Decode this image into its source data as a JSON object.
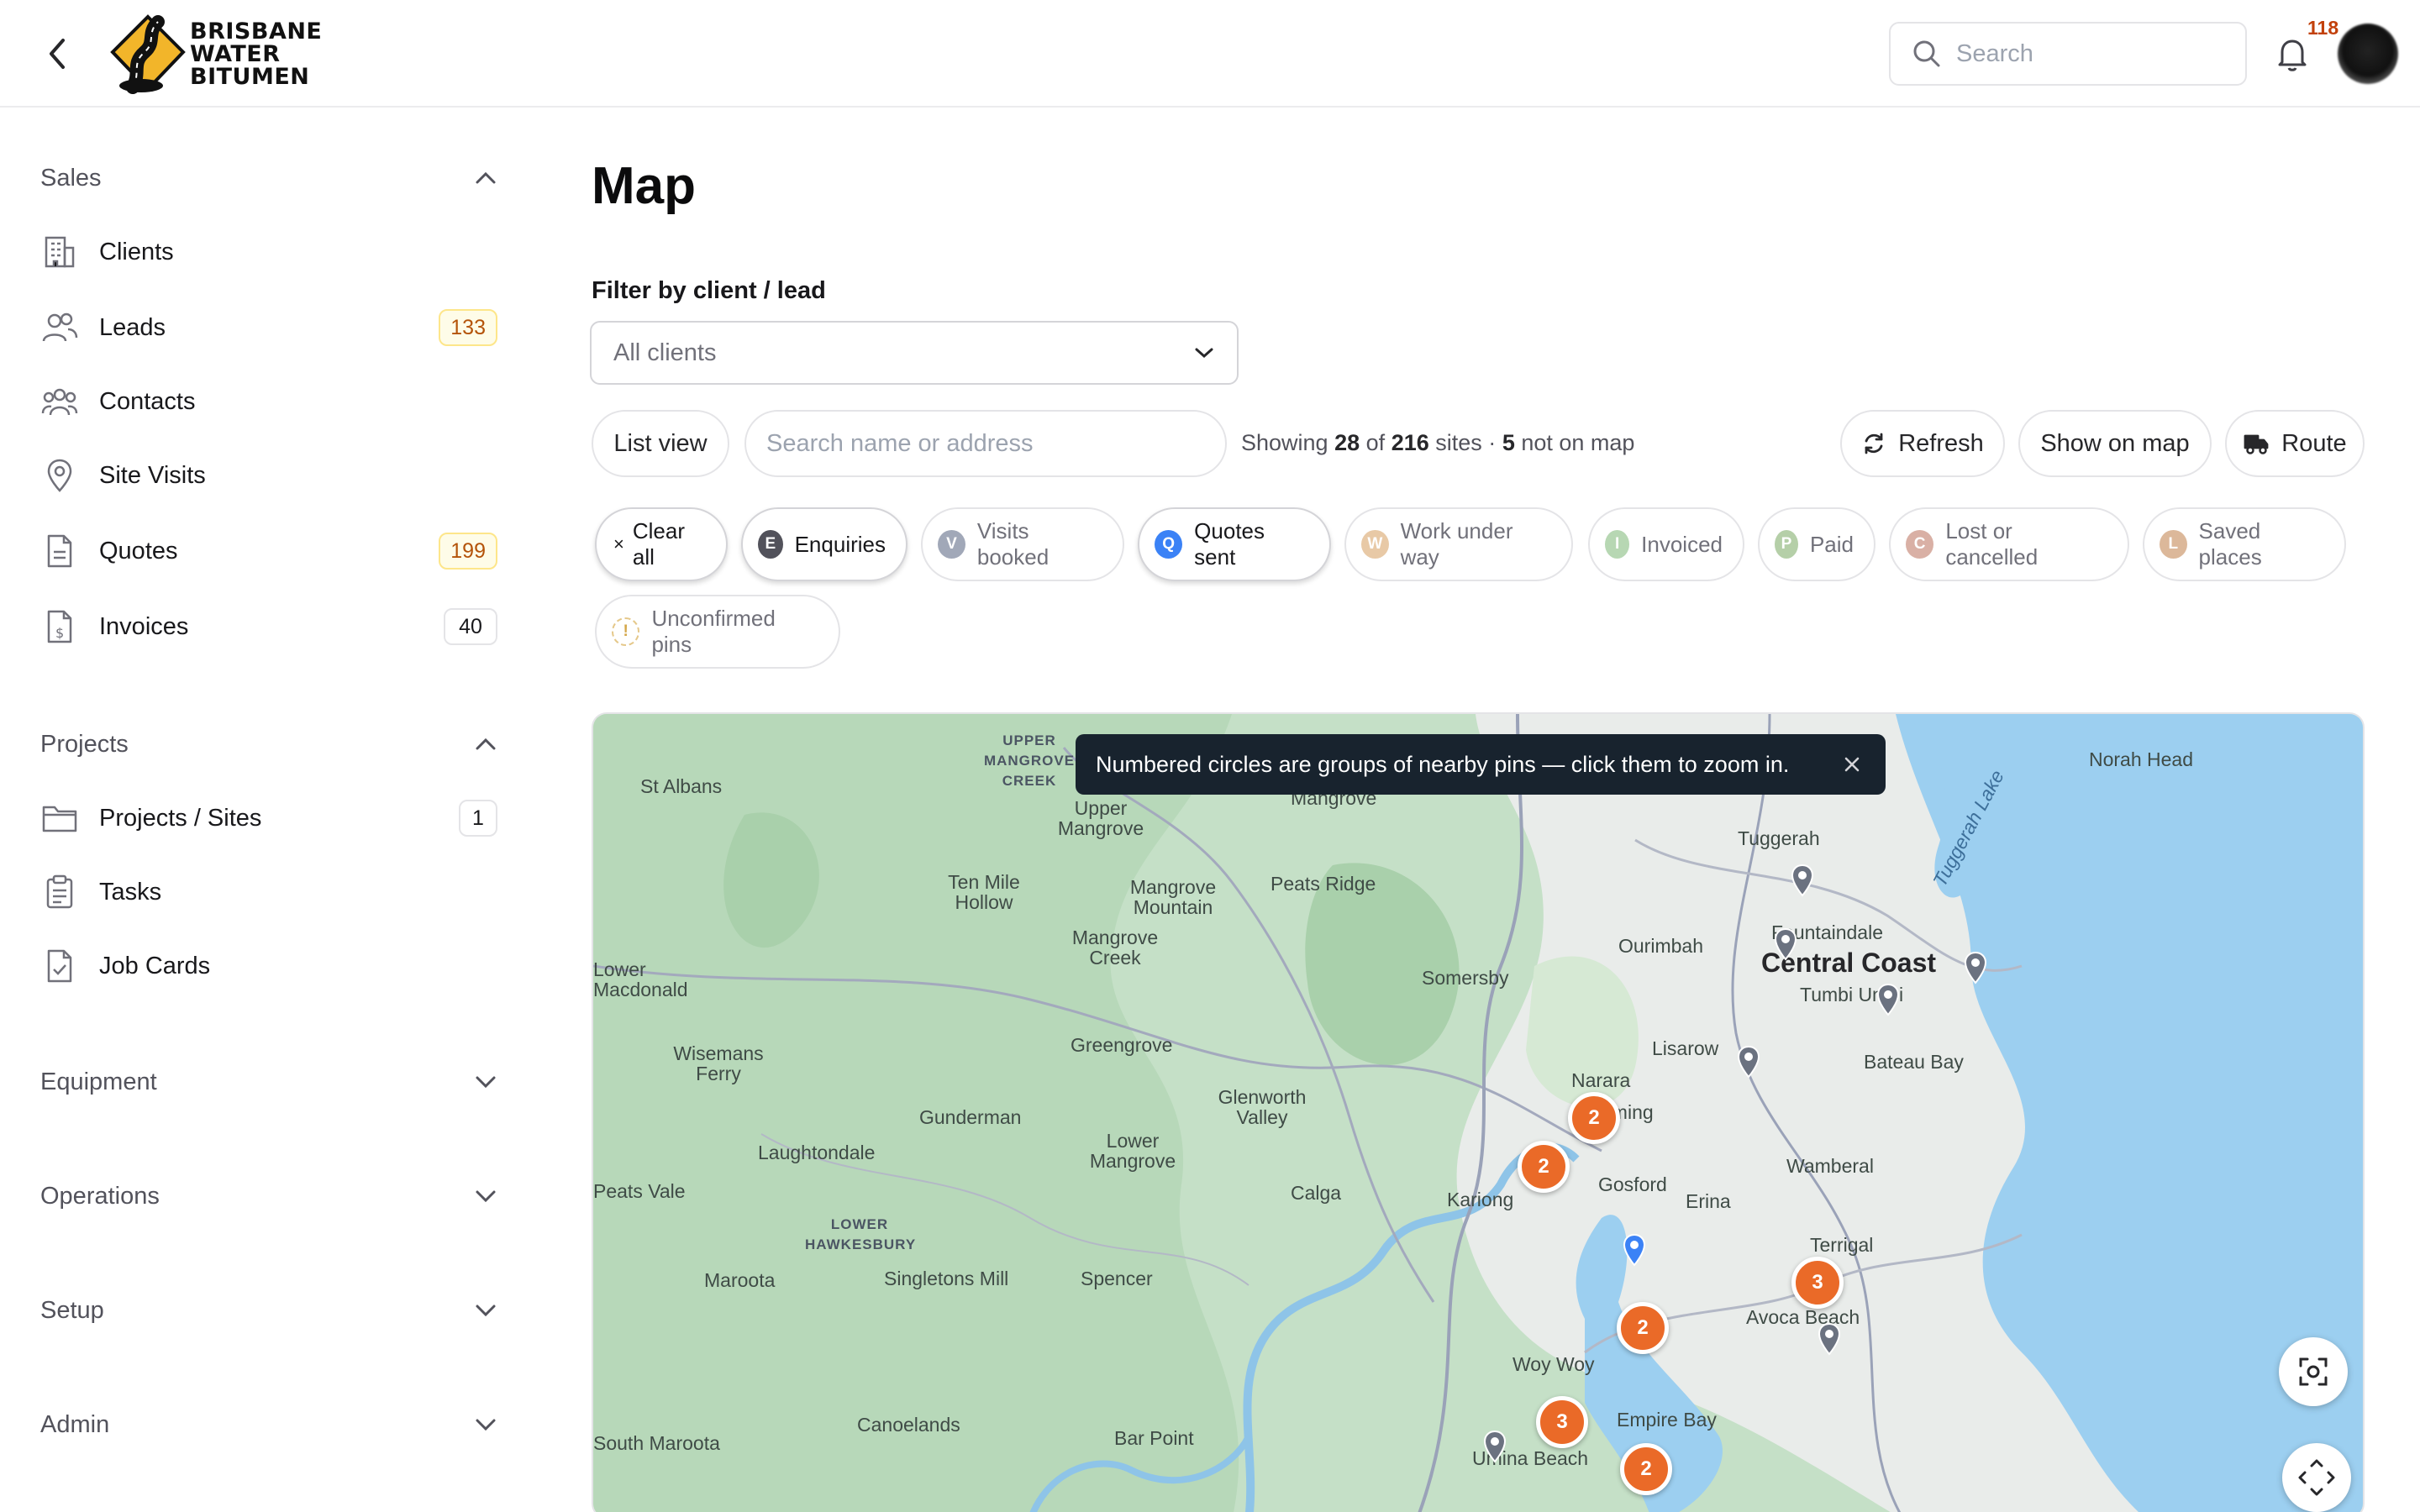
{
  "header": {
    "brand": {
      "line1": "BRISBANE",
      "line2": "WATER",
      "line3": "BITUMEN"
    },
    "search_placeholder": "Search",
    "notification_count": "118"
  },
  "sidebar": {
    "sales": {
      "title": "Sales",
      "items": [
        {
          "label": "Clients",
          "badge": ""
        },
        {
          "label": "Leads",
          "badge": "133"
        },
        {
          "label": "Contacts",
          "badge": ""
        },
        {
          "label": "Site Visits",
          "badge": ""
        },
        {
          "label": "Quotes",
          "badge": "199"
        },
        {
          "label": "Invoices",
          "badge": "40"
        }
      ]
    },
    "projects": {
      "title": "Projects",
      "items": [
        {
          "label": "Projects / Sites",
          "badge": "1"
        },
        {
          "label": "Tasks",
          "badge": ""
        },
        {
          "label": "Job Cards",
          "badge": ""
        }
      ]
    },
    "collapsed": [
      "Equipment",
      "Operations",
      "Setup",
      "Admin"
    ]
  },
  "main": {
    "title": "Map",
    "filter_label": "Filter by client / lead",
    "filter_value": "All clients",
    "list_view_label": "List view",
    "name_search_placeholder": "Search name or address",
    "showing": {
      "prefix": "Showing",
      "shown": "28",
      "of": "of",
      "total": "216",
      "sites": "sites ·",
      "not_on_map": "5",
      "suffix": "not on map"
    },
    "refresh_label": "Refresh",
    "show_on_map_label": "Show on map",
    "route_label": "Route",
    "chips": [
      {
        "letter": "",
        "label": "Clear all",
        "active": true
      },
      {
        "letter": "E",
        "label": "Enquiries",
        "active": true,
        "color": "#52525b"
      },
      {
        "letter": "V",
        "label": "Visits booked",
        "active": false,
        "color": "#a1a8b8"
      },
      {
        "letter": "Q",
        "label": "Quotes sent",
        "active": true,
        "color": "#3b82f6"
      },
      {
        "letter": "W",
        "label": "Work under way",
        "active": false,
        "color": "#e8c9a6"
      },
      {
        "letter": "I",
        "label": "Invoiced",
        "active": false,
        "color": "#b7d7b3"
      },
      {
        "letter": "P",
        "label": "Paid",
        "active": false,
        "color": "#b5cfa8"
      },
      {
        "letter": "C",
        "label": "Lost or cancelled",
        "active": false,
        "color": "#d9b0a5"
      },
      {
        "letter": "L",
        "label": "Saved places",
        "active": false,
        "color": "#dcb89a"
      },
      {
        "letter": "!",
        "label": "Unconfirmed pins",
        "active": false,
        "color": "#e5c88a"
      }
    ]
  },
  "map": {
    "tooltip": "Numbered circles are groups of nearby pins — click them to zoom in.",
    "places": [
      "St Albans",
      "UPPER MANGROVE CREEK",
      "Upper Mangrove",
      "Mangrove",
      "Tuggerah",
      "Norah Head",
      "Tuggerah Lake",
      "Ten Mile Hollow",
      "Mangrove Mountain",
      "Peats Ridge",
      "Mangrove Creek",
      "Ourimbah",
      "Fountaindale",
      "Central Coast",
      "Tumbi Umbi",
      "Lower Macdonald",
      "Somersby",
      "Wisemans Ferry",
      "Greengrove",
      "Lisarow",
      "Bateau Bay",
      "Narara",
      "Wyoming",
      "Glenworth Valley",
      "Gunderman",
      "Lower Mangrove",
      "Laughtondale",
      "Gosford",
      "Wamberal",
      "Peats Vale",
      "Calga",
      "Kariong",
      "Erina",
      "LOWER HAWKESBURY",
      "Terrigal",
      "Maroota",
      "Singletons Mill",
      "Spencer",
      "Avoca Beach",
      "Woy Woy",
      "Empire Bay",
      "Canoelands",
      "Bar Point",
      "South Maroota",
      "Umina Beach"
    ],
    "clusters": [
      "2",
      "2",
      "3",
      "2",
      "3",
      "2"
    ]
  }
}
